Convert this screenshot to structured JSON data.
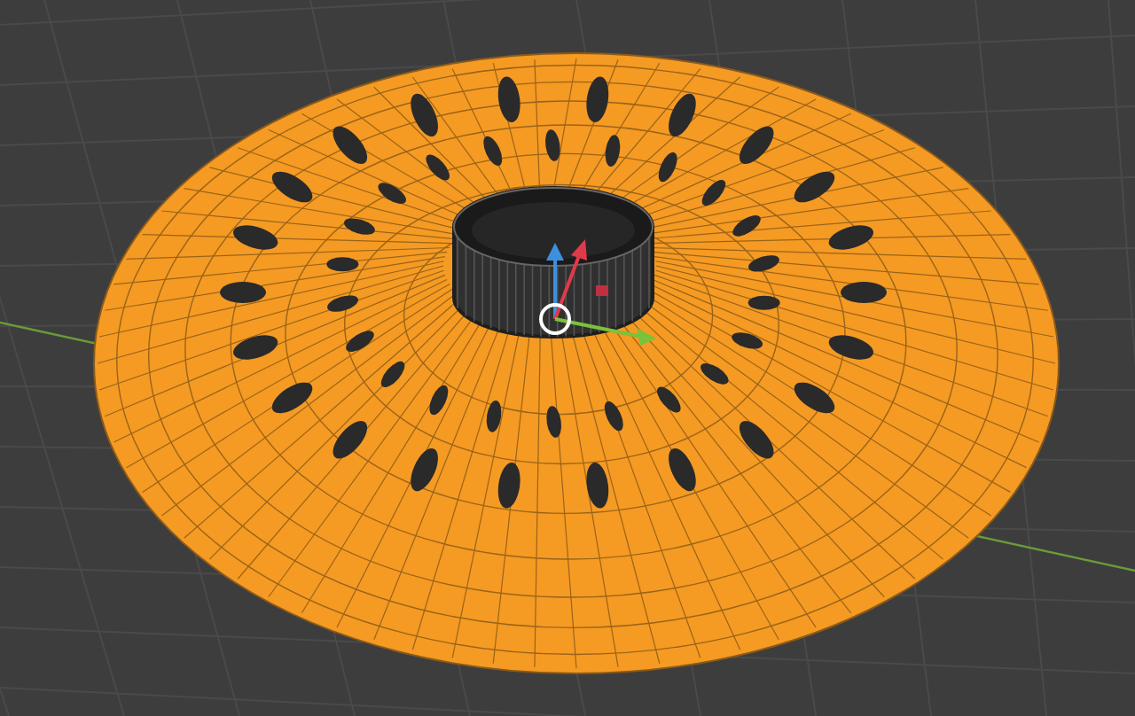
{
  "viewport": {
    "objects": [
      {
        "kind": "dome",
        "selected": true
      },
      {
        "kind": "cylinder",
        "selected": false
      }
    ]
  }
}
